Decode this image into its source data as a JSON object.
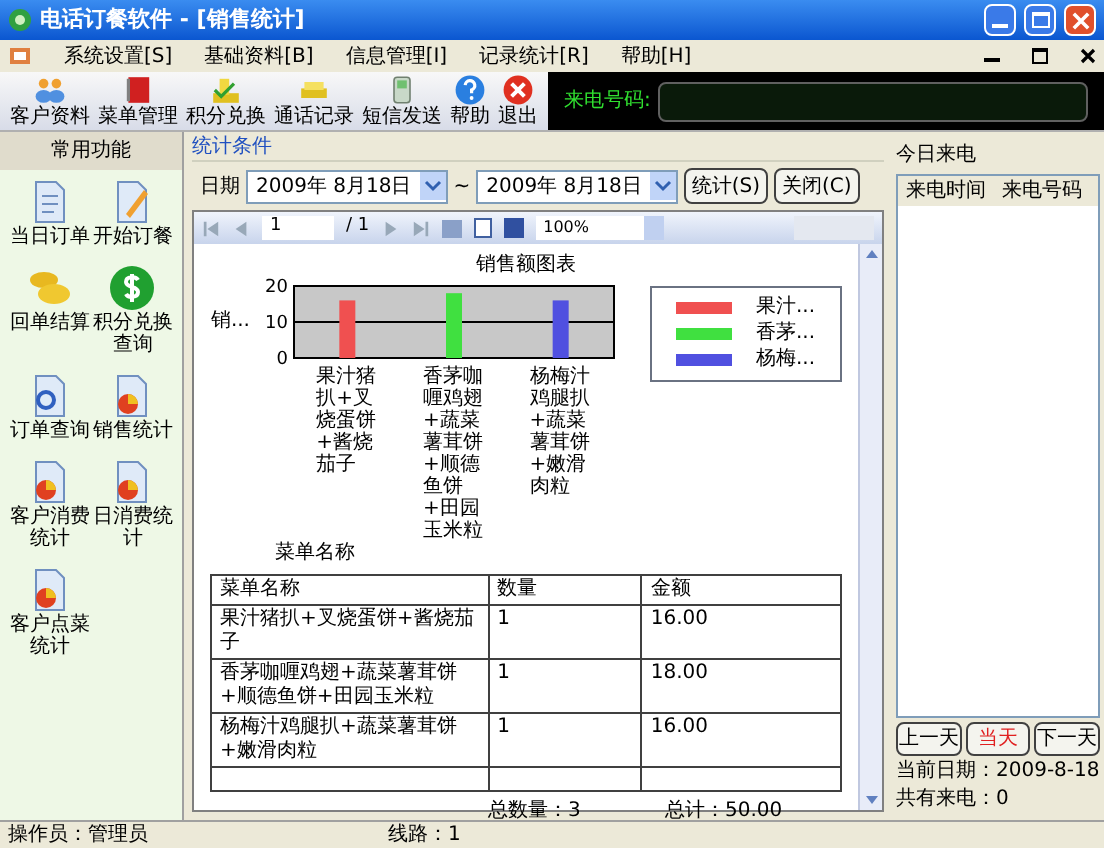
{
  "window": {
    "title": "电话订餐软件 - [销售统计]"
  },
  "menu": [
    "系统设置[S]",
    "基础资料[B]",
    "信息管理[I]",
    "记录统计[R]",
    "帮助[H]"
  ],
  "toolbar": [
    "客户资料",
    "菜单管理",
    "积分兑换",
    "通话记录",
    "短信发送",
    "帮助",
    "退出"
  ],
  "caller_panel": {
    "label": "来电号码:"
  },
  "sidebar": {
    "title": "常用功能",
    "items": [
      "当日订单",
      "开始订餐",
      "回单结算",
      "积分兑换查询",
      "订单查询",
      "销售统计",
      "客户消费统计",
      "日消费统计",
      "客户点菜统计"
    ]
  },
  "conditions": {
    "title": "统计条件",
    "date_label": "日期",
    "from": "2009年 8月18日",
    "separator": "~",
    "to": "2009年 8月18日",
    "buttons": [
      "统计(S)",
      "关闭(C)"
    ]
  },
  "viewer_toolbar": {
    "page": "1",
    "total": "/ 1",
    "zoom": "100%"
  },
  "report": {
    "chart_data": {
      "type": "bar",
      "title": "销售额图表",
      "legend": "right",
      "ylabel": "销...",
      "xlabel": "菜单名称",
      "categories": [
        "果汁猪扒+叉烧蛋饼+酱烧茄子",
        "香茅咖喱鸡翅+蔬菜薯茸饼+顺德鱼饼+田园玉米粒",
        "杨梅汁鸡腿扒+蔬菜薯茸饼+嫩滑肉粒"
      ],
      "ylim": [
        0,
        20
      ],
      "yticks": [
        0,
        10,
        20
      ],
      "series": [
        {
          "name": "果汁...",
          "color": "#f05050",
          "values": [
            16,
            null,
            null
          ]
        },
        {
          "name": "香茅...",
          "color": "#40e040",
          "values": [
            null,
            18,
            null
          ]
        },
        {
          "name": "杨梅...",
          "color": "#5050e0",
          "values": [
            null,
            null,
            16
          ]
        }
      ]
    },
    "table": {
      "columns": [
        "菜单名称",
        "数量",
        "金额"
      ],
      "rows": [
        [
          "果汁猪扒+叉烧蛋饼+酱烧茄子",
          "1",
          "16.00"
        ],
        [
          "香茅咖喱鸡翅+蔬菜薯茸饼+顺德鱼饼+田园玉米粒",
          "1",
          "18.00"
        ],
        [
          "杨梅汁鸡腿扒+蔬菜薯茸饼+嫩滑肉粒",
          "1",
          "16.00"
        ]
      ]
    },
    "total_count": "总数量：3",
    "total_amount": "总计：50.00"
  },
  "calls": {
    "title": "今日来电",
    "columns": [
      "来电时间",
      "来电号码"
    ],
    "buttons": [
      {
        "label": "上一天",
        "selected": false
      },
      {
        "label": "当天",
        "selected": true
      },
      {
        "label": "下一天",
        "selected": false
      }
    ],
    "current_date": "当前日期：2009-8-18",
    "count": "共有来电：0"
  },
  "status_bar": [
    "操作员：管理员",
    "线路：1"
  ]
}
